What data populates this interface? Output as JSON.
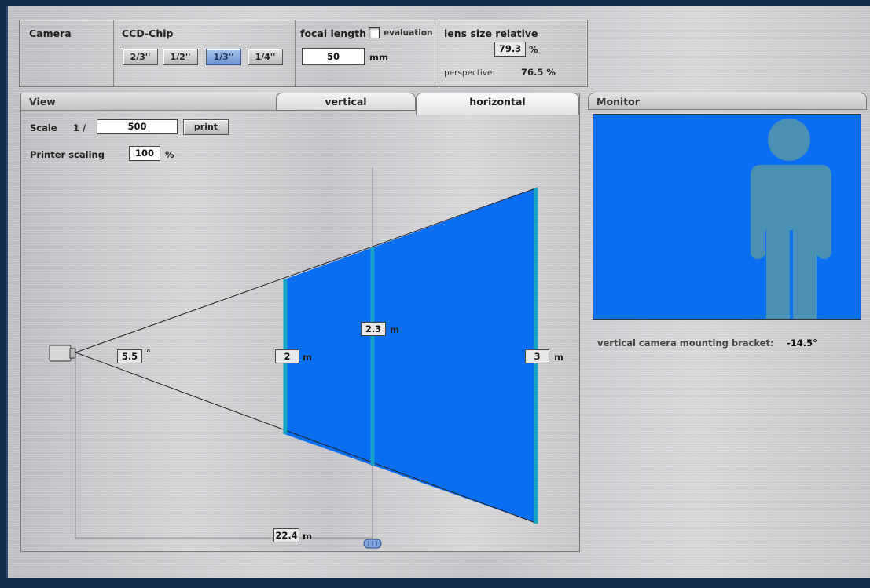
{
  "toolbar": {
    "camera_label": "Camera",
    "ccd_label": "CCD-Chip",
    "chip_sizes": [
      "2/3''",
      "1/2''",
      "1/3''",
      "1/4''"
    ],
    "active_chip": "1/3''",
    "focal_label": "focal length",
    "evaluation_label": "evaluation",
    "focal_value": "50",
    "focal_unit": "mm",
    "lens_label": "lens size relative",
    "lens_value": "79.3",
    "lens_unit": "%",
    "perspective_label": "perspective:",
    "perspective_value": "76.5 %"
  },
  "view": {
    "title": "View",
    "tabs": [
      "vertical",
      "horizontal"
    ],
    "active_tab": "horizontal",
    "scale_label": "Scale",
    "scale_prefix": "1 /",
    "scale_value": "500",
    "print_label": "print",
    "printer_scaling_label": "Printer scaling",
    "printer_scaling_value": "100",
    "printer_scaling_unit": "%",
    "angle_value": "5.5",
    "angle_unit": "°",
    "near_width_value": "2",
    "mid_width_value": "2.3",
    "far_width_value": "3",
    "distance_value": "22.4",
    "unit_m": "m"
  },
  "monitor": {
    "title": "Monitor",
    "bracket_label": "vertical camera mounting bracket:",
    "bracket_value": "-14.5°"
  },
  "colors": {
    "fov_fill": "#0a6ef2",
    "plane_line": "#18a4c4",
    "figure": "#4a8fb4"
  },
  "icons": [
    "camera-icon",
    "slider-handle-icon",
    "person-silhouette-icon",
    "checkbox-icon"
  ]
}
